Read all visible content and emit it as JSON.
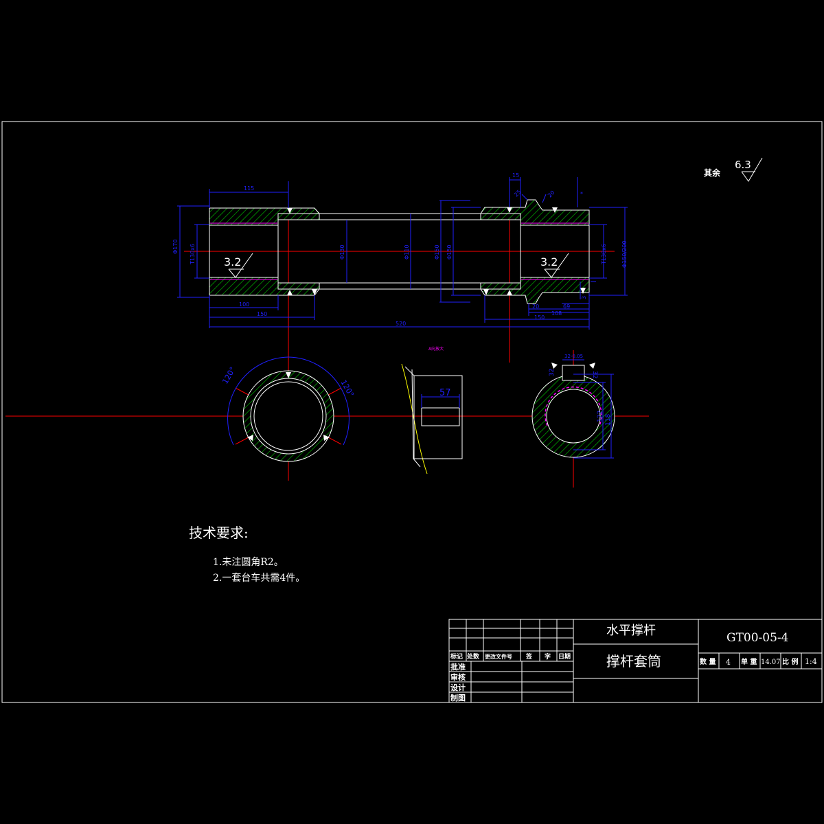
{
  "colors": {
    "background": "#000000",
    "outline": "#ffffff",
    "dimension": "#2020ff",
    "centerline": "#ff0000",
    "hatch": "#00c000",
    "thread": "#ff00ff",
    "leader": "#ffff00"
  },
  "roughness": {
    "other_label": "其余",
    "other_value": "6.3",
    "left_value": "3.2",
    "right_value": "3.2"
  },
  "dims": {
    "d115": "115",
    "d15": "15",
    "d25": "25",
    "d20": "20",
    "star": "*",
    "phi170": "Φ170",
    "m130": "T130x6",
    "phi130": "Φ130",
    "phi110": "Φ110",
    "phi150a": "Φ150",
    "phi150b": "Φ150",
    "m130r": "T130x6",
    "phi200": "Φ150/200",
    "d100": "100",
    "d150": "150",
    "d520": "520",
    "d20b": "20",
    "d69": "69",
    "d108": "108",
    "d150b": "150",
    "d3": "3",
    "d122": "122",
    "d118": "118",
    "key": "32",
    "keyb": "32",
    "keyw": "32-0.05",
    "d57": "57",
    "a120a": "120°",
    "a120b": "120°",
    "tiny": "A向放大"
  },
  "tech": {
    "heading": "技术要求:",
    "items": [
      "1.未注圆角R2。",
      "2.一套台车共需4件。"
    ]
  },
  "title_block": {
    "assembly": "水平撑杆",
    "part": "撑杆套筒",
    "drawing_no": "GT00-05-4",
    "qty_label": "数 量",
    "qty": "4",
    "weight_label": "单 重",
    "weight": "14.07",
    "scale_label": "比 例",
    "scale": "1:4",
    "revision_headers": [
      "标记",
      "处数",
      "更改文件号",
      "签",
      "字",
      "日期"
    ],
    "roles": [
      "批准",
      "审核",
      "设计",
      "制图"
    ]
  }
}
